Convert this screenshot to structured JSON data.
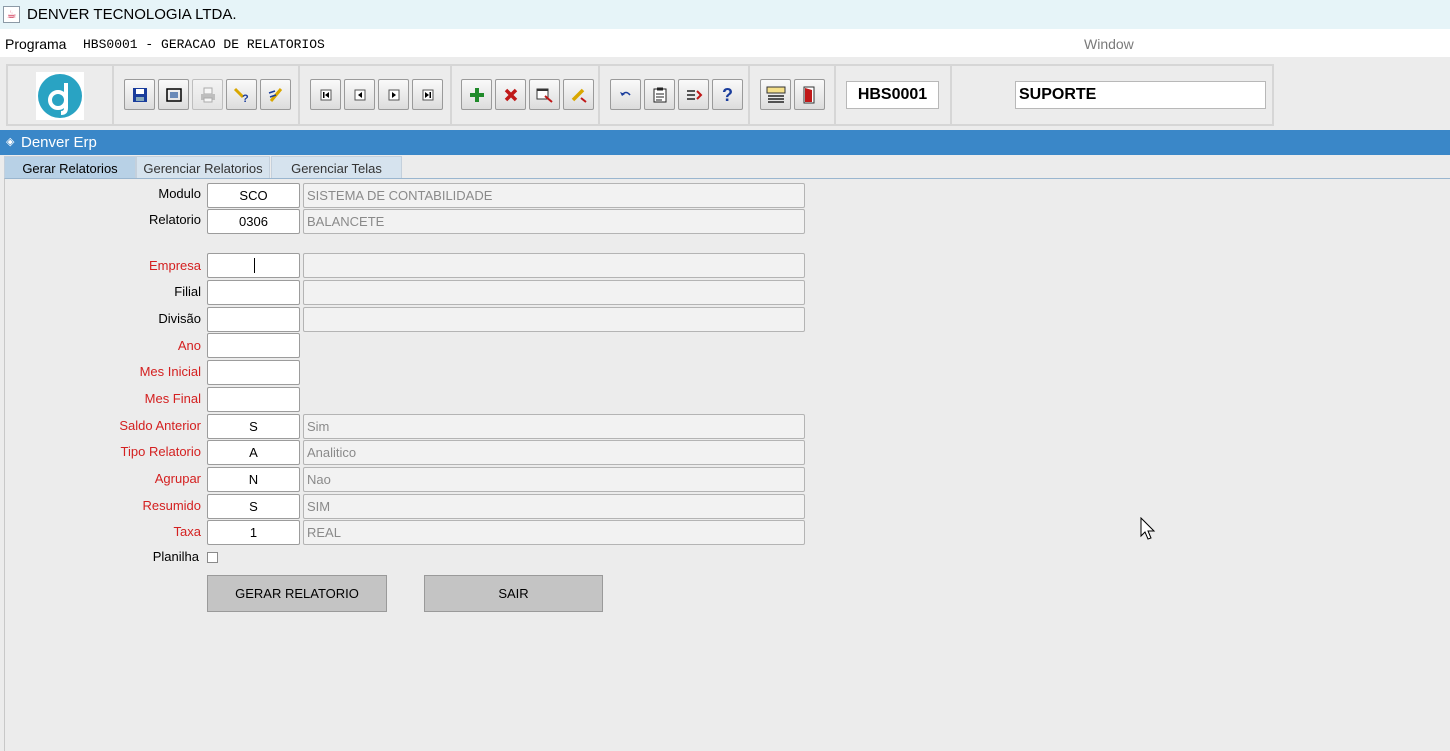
{
  "window": {
    "title": "DENVER TECNOLOGIA LTDA."
  },
  "menubar": {
    "programa_label": "Programa",
    "program_caption": "HBS0001 - GERACAO DE RELATORIOS",
    "window_label": "Window"
  },
  "toolbar": {
    "program_code": "HBS0001",
    "user": "SUPORTE",
    "icons": [
      "save-icon",
      "window-icon",
      "print-icon",
      "query-icon",
      "edit-query-icon",
      "first-record-icon",
      "previous-record-icon",
      "next-record-icon",
      "last-record-icon",
      "insert-record-icon",
      "delete-record-icon",
      "duplicate-record-icon",
      "clear-record-icon",
      "undo-icon",
      "clipboard-icon",
      "list-icon",
      "help-icon",
      "menu-icon",
      "exit-icon"
    ]
  },
  "inner_window": {
    "title": "Denver Erp"
  },
  "tabs": [
    "Gerar Relatorios",
    "Gerenciar Relatorios",
    "Gerenciar Telas"
  ],
  "form": {
    "modulo": {
      "label": "Modulo",
      "code": "SCO",
      "desc": "SISTEMA DE CONTABILIDADE"
    },
    "relatorio": {
      "label": "Relatorio",
      "code": "0306",
      "desc": "BALANCETE"
    },
    "empresa": {
      "label": "Empresa",
      "code": "",
      "desc": ""
    },
    "filial": {
      "label": "Filial",
      "code": "",
      "desc": ""
    },
    "divisao": {
      "label": "Divisão",
      "code": "",
      "desc": ""
    },
    "ano": {
      "label": "Ano",
      "code": ""
    },
    "mes_inicial": {
      "label": "Mes Inicial",
      "code": ""
    },
    "mes_final": {
      "label": "Mes Final",
      "code": ""
    },
    "saldo_anterior": {
      "label": "Saldo Anterior",
      "code": "S",
      "desc": "Sim"
    },
    "tipo_relatorio": {
      "label": "Tipo Relatorio",
      "code": "A",
      "desc": "Analitico"
    },
    "agrupar": {
      "label": "Agrupar",
      "code": "N",
      "desc": "Nao"
    },
    "resumido": {
      "label": "Resumido",
      "code": "S",
      "desc": "SIM"
    },
    "taxa": {
      "label": "Taxa",
      "code": "1",
      "desc": "REAL"
    },
    "planilha": {
      "label": "Planilha",
      "checked": false
    }
  },
  "buttons": {
    "gerar": "GERAR RELATORIO",
    "sair": "SAIR"
  },
  "colors": {
    "header_blue": "#3a87c8",
    "required_label": "#d42020",
    "logo_teal": "#29a3c3"
  }
}
